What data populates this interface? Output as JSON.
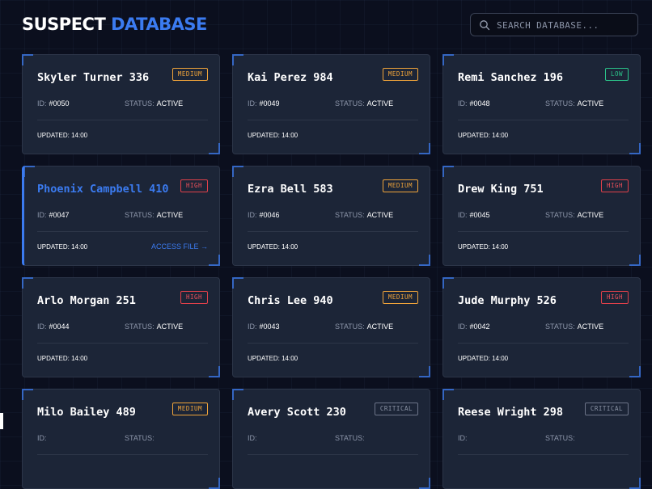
{
  "header": {
    "title_main": "SUSPECT",
    "title_accent": "DATABASE"
  },
  "search": {
    "placeholder": "SEARCH DATABASE...",
    "icon": "search-icon"
  },
  "colors": {
    "accent": "#3b7bf0",
    "medium": "#f0a43a",
    "high": "#f0505a",
    "low": "#2bc48a",
    "critical": "#8c94a6"
  },
  "labels": {
    "id": "ID:",
    "status": "STATUS:",
    "access": "ACCESS FILE →"
  },
  "cards": [
    {
      "name": "Skyler Turner 336",
      "badge": "MEDIUM",
      "level": "medium",
      "id": "#0050",
      "status": "ACTIVE",
      "updated": "UPDATED: 14:00"
    },
    {
      "name": "Kai Perez 984",
      "badge": "MEDIUM",
      "level": "medium",
      "id": "#0049",
      "status": "ACTIVE",
      "updated": "UPDATED: 14:00"
    },
    {
      "name": "Remi Sanchez 196",
      "badge": "LOW",
      "level": "low",
      "id": "#0048",
      "status": "ACTIVE",
      "updated": "UPDATED: 14:00"
    },
    {
      "name": "Phoenix Campbell 410",
      "badge": "HIGH",
      "level": "high",
      "id": "#0047",
      "status": "ACTIVE",
      "updated": "UPDATED: 14:00",
      "selected": true
    },
    {
      "name": "Ezra Bell 583",
      "badge": "MEDIUM",
      "level": "medium",
      "id": "#0046",
      "status": "ACTIVE",
      "updated": "UPDATED: 14:00"
    },
    {
      "name": "Drew King 751",
      "badge": "HIGH",
      "level": "high",
      "id": "#0045",
      "status": "ACTIVE",
      "updated": "UPDATED: 14:00"
    },
    {
      "name": "Arlo Morgan 251",
      "badge": "HIGH",
      "level": "high",
      "id": "#0044",
      "status": "ACTIVE",
      "updated": "UPDATED: 14:00"
    },
    {
      "name": "Chris Lee 940",
      "badge": "MEDIUM",
      "level": "medium",
      "id": "#0043",
      "status": "ACTIVE",
      "updated": "UPDATED: 14:00"
    },
    {
      "name": "Jude Murphy 526",
      "badge": "HIGH",
      "level": "high",
      "id": "#0042",
      "status": "ACTIVE",
      "updated": "UPDATED: 14:00"
    },
    {
      "name": "Milo Bailey 489",
      "badge": "MEDIUM",
      "level": "medium"
    },
    {
      "name": "Avery Scott 230",
      "badge": "CRITICAL",
      "level": "critical"
    },
    {
      "name": "Reese Wright 298",
      "badge": "CRITICAL",
      "level": "critical"
    }
  ]
}
